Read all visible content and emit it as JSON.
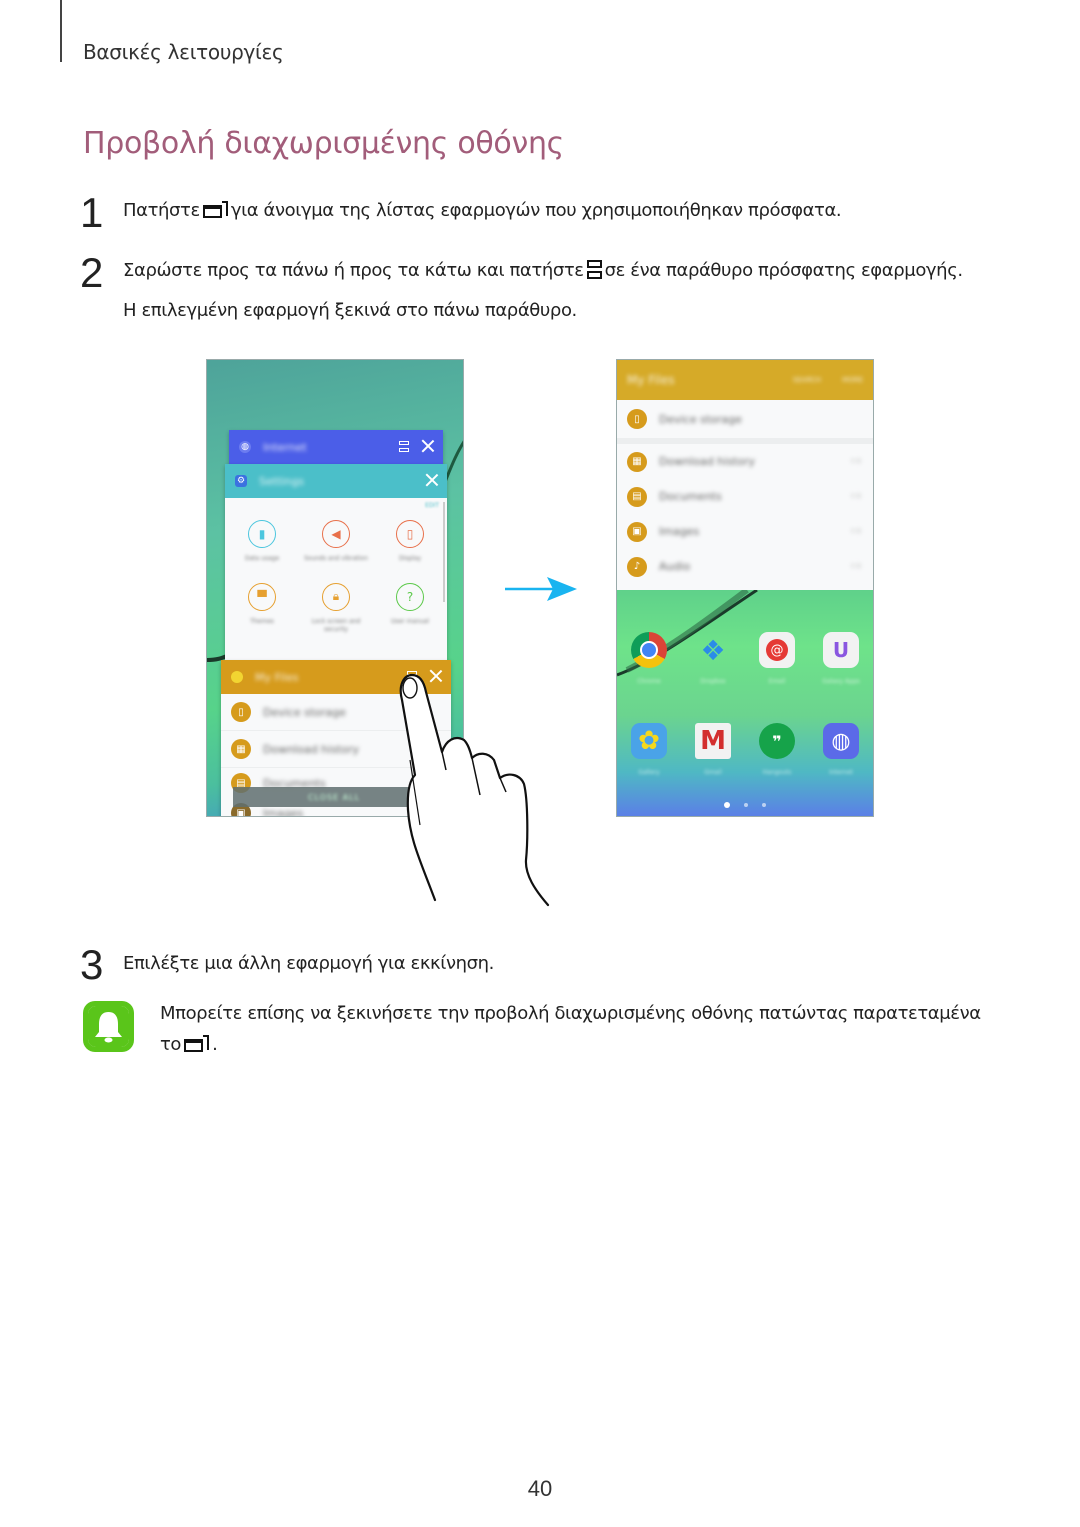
{
  "header": {
    "section": "Βασικές λειτουργίες",
    "title": "Προβολή διαχωρισμένης οθόνης"
  },
  "steps": [
    {
      "number": "1",
      "before": "Πατήστε",
      "icon": "recent-apps-icon",
      "after": "για άνοιγμα της λίστας εφαρμογών που χρησιμοποιήθηκαν πρόσφατα."
    },
    {
      "number": "2",
      "before": "Σαρώστε προς τα πάνω ή προς τα κάτω και πατήστε",
      "icon": "split-screen-icon",
      "after": "σε ένα παράθυρο πρόσφατης εφαρμογής.",
      "line2": "Η επιλεγμένη εφαρμογή ξεκινά στο πάνω παράθυρο."
    },
    {
      "number": "3",
      "text": "Επιλέξτε μια άλλη εφαρμογή για εκκίνηση."
    }
  ],
  "note": {
    "icon": "bell-notice-icon",
    "line1": "Μπορείτε επίσης να ξεκινήσετε την προβολή διαχωρισμένης οθόνης πατώντας παρατεταμένα",
    "line2_before": "το",
    "line2_icon": "recent-apps-icon",
    "line2_after": "."
  },
  "illustration": {
    "left_phone": {
      "cards": [
        {
          "app": "Internet",
          "color": "#4b5ee8",
          "icon": "globe-icon"
        },
        {
          "app": "Settings",
          "color": "#4bbfc9",
          "icon": "gear-icon",
          "edit": "EDIT",
          "items": [
            {
              "label": "Data usage",
              "icon": "bar-chart-icon",
              "color": "#4cc6de"
            },
            {
              "label": "Sounds and vibration",
              "icon": "speaker-icon",
              "color": "#e8704a"
            },
            {
              "label": "Display",
              "icon": "display-icon",
              "color": "#e8704a"
            },
            {
              "label": "Themes",
              "icon": "brush-icon",
              "color": "#e6a030"
            },
            {
              "label": "Lock screen and security",
              "icon": "lock-icon",
              "color": "#e6a030"
            },
            {
              "label": "User manual",
              "icon": "manual-icon",
              "color": "#5cc94a"
            }
          ]
        },
        {
          "app": "My Files",
          "color": "#d69b1c",
          "icon": "folder-icon",
          "rows": [
            "Device storage",
            "Download history",
            "Documents",
            "Images"
          ]
        }
      ],
      "close_all": "CLOSE ALL"
    },
    "right_phone": {
      "top_app": {
        "title": "My Files",
        "actions": [
          "SEARCH",
          "MORE"
        ],
        "rows": [
          {
            "label": "Device storage",
            "icon": "phone-storage-icon"
          },
          {
            "label": "Download history",
            "icon": "download-icon",
            "meta": "0 B"
          },
          {
            "label": "Documents",
            "icon": "document-icon",
            "meta": "0 B"
          },
          {
            "label": "Images",
            "icon": "image-icon",
            "meta": "0 B"
          },
          {
            "label": "Audio",
            "icon": "music-note-icon",
            "meta": "0 B"
          }
        ]
      },
      "home_apps": [
        {
          "label": "Chrome",
          "icon": "chrome-icon"
        },
        {
          "label": "Dropbox",
          "icon": "dropbox-icon"
        },
        {
          "label": "Email",
          "icon": "email-icon"
        },
        {
          "label": "Galaxy Apps",
          "icon": "galaxy-apps-icon"
        },
        {
          "label": "Gallery",
          "icon": "gallery-icon"
        },
        {
          "label": "Gmail",
          "icon": "gmail-icon"
        },
        {
          "label": "Hangouts",
          "icon": "hangouts-icon"
        },
        {
          "label": "Internet",
          "icon": "internet-icon"
        }
      ],
      "page_indicator": {
        "pages": 3,
        "current": 1
      }
    },
    "arrow_color": "#19b4f0"
  },
  "colors": {
    "title": "#a25d7a",
    "note_icon": "#5ac51a"
  },
  "page_number": "40"
}
